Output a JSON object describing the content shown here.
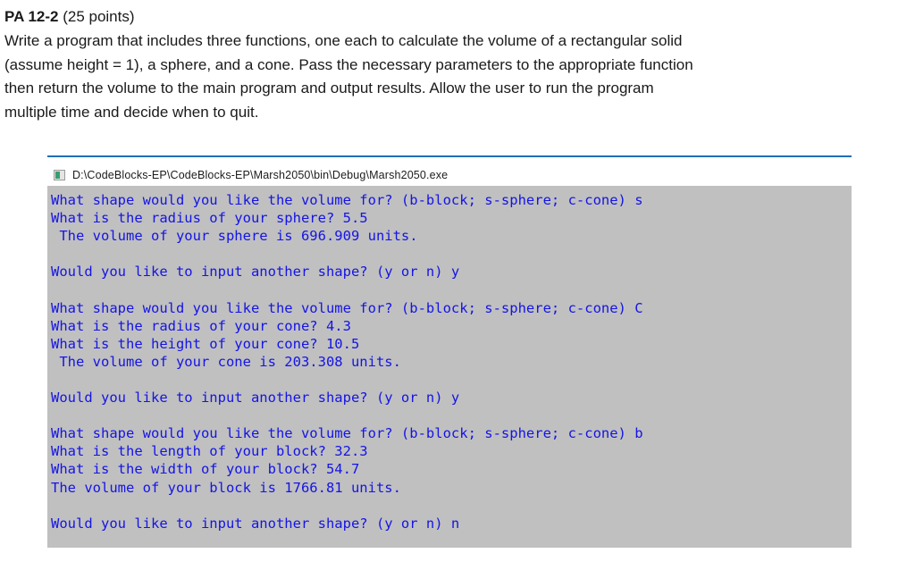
{
  "prompt": {
    "title_id": "PA 12-2",
    "title_points": " (25 points)",
    "body_lines": [
      "Write a program that includes three functions, one each to calculate the volume of a rectangular solid",
      "(assume height = 1), a sphere, and a cone. Pass the necessary parameters to the appropriate function",
      "then return the volume to the main program and output results. Allow the user to run the program",
      "multiple time and decide when to quit."
    ]
  },
  "console": {
    "icon": "application-window-icon",
    "title": "D:\\CodeBlocks-EP\\CodeBlocks-EP\\Marsh2050\\bin\\Debug\\Marsh2050.exe",
    "text_color": "#1414e6",
    "background_color": "#c0c0c0",
    "lines": [
      "What shape would you like the volume for? (b-block; s-sphere; c-cone) s",
      "What is the radius of your sphere? 5.5",
      " The volume of your sphere is 696.909 units.",
      "",
      "Would you like to input another shape? (y or n) y",
      "",
      "What shape would you like the volume for? (b-block; s-sphere; c-cone) C",
      "What is the radius of your cone? 4.3",
      "What is the height of your cone? 10.5",
      " The volume of your cone is 203.308 units.",
      "",
      "Would you like to input another shape? (y or n) y",
      "",
      "What shape would you like the volume for? (b-block; s-sphere; c-cone) b",
      "What is the length of your block? 32.3",
      "What is the width of your block? 54.7",
      "The volume of your block is 1766.81 units.",
      "",
      "Would you like to input another shape? (y or n) n",
      ""
    ]
  },
  "separator": {
    "color": "#1f6fb5"
  }
}
